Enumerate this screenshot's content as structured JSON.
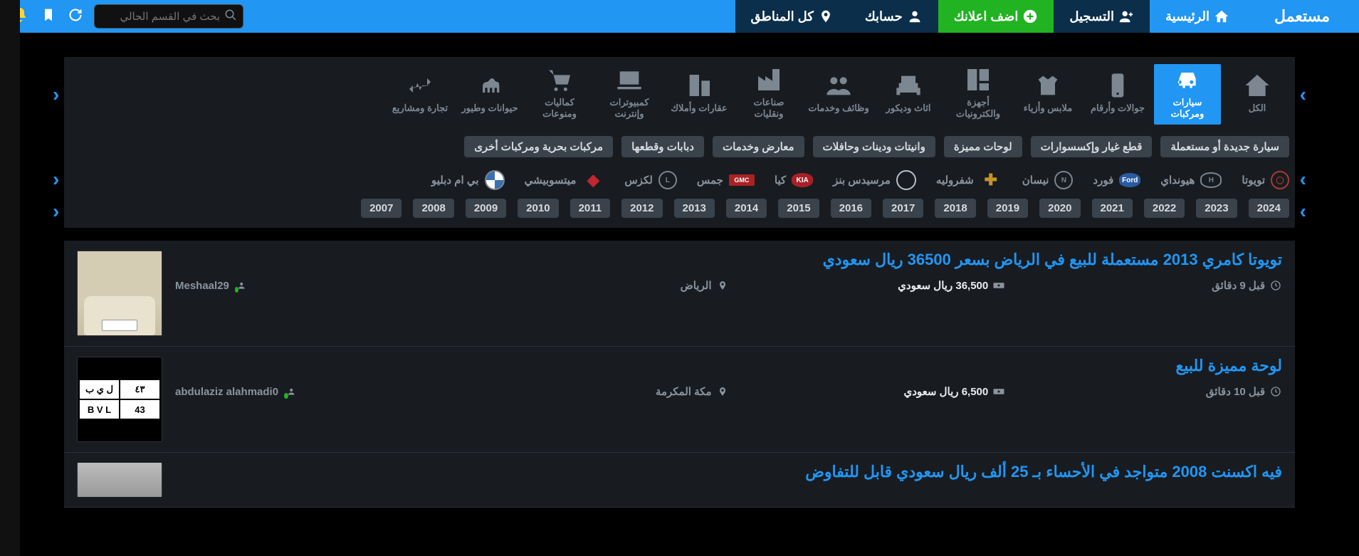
{
  "header": {
    "logo_text": "مستعمل",
    "nav": {
      "home": "الرئيسية",
      "register": "التسجيل",
      "add_ad": "اضف اعلانك",
      "account": "حسابك",
      "regions": "كل المناطق"
    },
    "search_placeholder": "بحث في القسم الحالي"
  },
  "categories": [
    {
      "id": "all",
      "label": "الكل",
      "icon": "home"
    },
    {
      "id": "cars",
      "label": "سيارات ومركبات",
      "icon": "car",
      "active": true
    },
    {
      "id": "phones",
      "label": "جوالات وأرقام",
      "icon": "phone"
    },
    {
      "id": "fashion",
      "label": "ملابس وأزياء",
      "icon": "clothes"
    },
    {
      "id": "electronics",
      "label": "أجهزة والكترونيات",
      "icon": "appliance"
    },
    {
      "id": "furniture",
      "label": "اثاث وديكور",
      "icon": "furniture"
    },
    {
      "id": "jobs",
      "label": "وظائف وخدمات",
      "icon": "people"
    },
    {
      "id": "industry",
      "label": "صناعات ونقليات",
      "icon": "industry"
    },
    {
      "id": "realestate",
      "label": "عقارات وأملاك",
      "icon": "building"
    },
    {
      "id": "computers",
      "label": "كمبيوترات وإنترنت",
      "icon": "laptop"
    },
    {
      "id": "accessories",
      "label": "كماليات ومنوعات",
      "icon": "cart"
    },
    {
      "id": "animals",
      "label": "حيوانات وطيور",
      "icon": "camel"
    },
    {
      "id": "trade",
      "label": "تجارة ومشاريع",
      "icon": "trade"
    }
  ],
  "subcategories": [
    "سيارة جديدة أو مستعملة",
    "قطع غيار وإكسسوارات",
    "لوحات مميزة",
    "وانيتات ودينات وحافلات",
    "معارض وخدمات",
    "دبابات وقطعها",
    "مركبات بحرية ومركبات أخرى"
  ],
  "brands": [
    {
      "id": "toyota",
      "label": "تويوتا"
    },
    {
      "id": "hyundai",
      "label": "هيونداي"
    },
    {
      "id": "ford",
      "label": "فورد"
    },
    {
      "id": "nissan",
      "label": "نيسان"
    },
    {
      "id": "chevrolet",
      "label": "شفروليه"
    },
    {
      "id": "mercedes",
      "label": "مرسيدس بنز"
    },
    {
      "id": "kia",
      "label": "كيا"
    },
    {
      "id": "gmc",
      "label": "جمس"
    },
    {
      "id": "lexus",
      "label": "لكزس"
    },
    {
      "id": "mitsubishi",
      "label": "ميتسوبيشي"
    },
    {
      "id": "bmw",
      "label": "بي ام دبليو"
    }
  ],
  "years": [
    "2024",
    "2023",
    "2022",
    "2021",
    "2020",
    "2019",
    "2018",
    "2017",
    "2016",
    "2015",
    "2014",
    "2013",
    "2012",
    "2011",
    "2010",
    "2009",
    "2008",
    "2007"
  ],
  "listings": [
    {
      "title": "تويوتا كامري 2013 مستعملة للبيع في الرياض بسعر 36500 ريال سعودي",
      "time": "قبل 9 دقائق",
      "price": "36,500 ريال سعودي",
      "location": "الرياض",
      "user": "Meshaal29",
      "thumb": "car"
    },
    {
      "title": "لوحة مميزة للبيع",
      "time": "قبل 10 دقائق",
      "price": "6,500 ريال سعودي",
      "location": "مكة المكرمة",
      "user": "abdulaziz alahmadi0",
      "thumb": "plate",
      "plate": {
        "ar_letters": "ل ي ب",
        "ar_num": "٤٣",
        "en_letters": "B V L",
        "en_num": "43"
      }
    },
    {
      "title": "فيه اكسنت 2008 متواجد في الأحساء بـ 25 ألف ريال سعودي قابل للتفاوض",
      "time": "",
      "price": "",
      "location": "",
      "user": "",
      "thumb": "partial"
    }
  ]
}
